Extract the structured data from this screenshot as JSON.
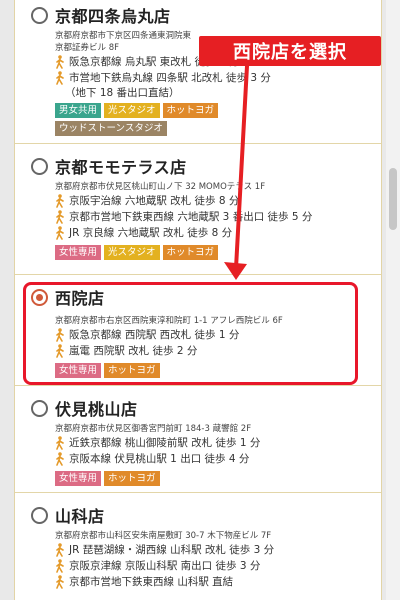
{
  "callout": {
    "text": "西院店を選択"
  },
  "stores": [
    {
      "name": "京都四条烏丸店",
      "address": [
        "京都府京都市下京区四条通東洞院東",
        "京都証券ビル 8F"
      ],
      "access": [
        {
          "text": "阪急京都線 烏丸駅 東改札 徒歩 1 分"
        },
        {
          "text": "市営地下鉄烏丸線 四条駅 北改札 徒歩 3 分"
        }
      ],
      "note": "（地下 18 番出口直結）",
      "tags": [
        "男女共用",
        "光スタジオ",
        "ホットヨガ",
        "ウッドストーンスタジオ"
      ],
      "checked": false
    },
    {
      "name": "京都モモテラス店",
      "address": [
        "京都府京都市伏見区桃山町山ノ下 32 MOMOテラス 1F"
      ],
      "access": [
        {
          "text": "京阪宇治線 六地蔵駅 改札 徒歩 8 分"
        },
        {
          "text": "京都市営地下鉄東西線 六地蔵駅 3 番出口 徒歩 5 分"
        },
        {
          "text": "JR 京良線 六地蔵駅 改札 徒歩 8 分"
        }
      ],
      "note": "",
      "tags": [
        "女性専用",
        "光スタジオ",
        "ホットヨガ"
      ],
      "checked": false
    },
    {
      "name": "西院店",
      "address": [
        "京都府京都市右京区西院東淳和院町 1-1 アフレ西院ビル 6F"
      ],
      "access": [
        {
          "text": "阪急京都線 西院駅 西改札 徒歩 1 分"
        },
        {
          "text": "嵐電 西院駅 改札 徒歩 2 分"
        }
      ],
      "note": "",
      "tags": [
        "女性専用",
        "ホットヨガ"
      ],
      "checked": true
    },
    {
      "name": "伏見桃山店",
      "address": [
        "京都府京都市伏見区御香宮門前町 184-3 蔵響館 2F"
      ],
      "access": [
        {
          "text": "近鉄京都線 桃山御陵前駅 改札 徒歩 1 分"
        },
        {
          "text": "京阪本線 伏見桃山駅 1 出口 徒歩 4 分"
        }
      ],
      "note": "",
      "tags": [
        "女性専用",
        "ホットヨガ"
      ],
      "checked": false
    },
    {
      "name": "山科店",
      "address": [
        "京都府京都市山科区安朱南屋敷町 30-7 木下物産ビル 7F"
      ],
      "access": [
        {
          "text": "JR 琵琶湖線・湖西線 山科駅 改札 徒歩 3 分"
        },
        {
          "text": "京阪京津線 京阪山科駅 南出口 徒歩 3 分"
        },
        {
          "text": "京都市営地下鉄東西線 山科駅 直結"
        }
      ],
      "note": "",
      "tags": [],
      "checked": false
    }
  ],
  "colors": {
    "accent_red": "#e61f23",
    "radio_checked": "#d05a3a",
    "walker_orange": "#e49a2a",
    "tag_green": "#3aa58d",
    "tag_yellow": "#e3b120",
    "tag_orange": "#e08a2a",
    "tag_brown": "#9b8464",
    "tag_pink": "#dc6b84"
  }
}
